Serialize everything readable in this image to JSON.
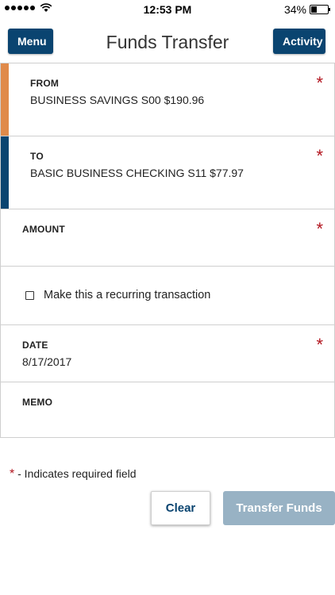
{
  "status_bar": {
    "time": "12:53 PM",
    "battery": "34%",
    "battery_level": 0.34,
    "wifi_icon": "wifi-icon"
  },
  "nav": {
    "menu_label": "Menu",
    "title": "Funds Transfer",
    "activity_label": "Activity"
  },
  "form": {
    "from": {
      "label": "FROM",
      "value": "BUSINESS SAVINGS S00 $190.96",
      "required": "*"
    },
    "to": {
      "label": "TO",
      "value": "BASIC BUSINESS CHECKING S11 $77.97",
      "required": "*"
    },
    "amount": {
      "label": "AMOUNT",
      "value": "",
      "required": "*"
    },
    "recurring": {
      "label": "Make this a recurring transaction",
      "checked": false
    },
    "date": {
      "label": "DATE",
      "value": "8/17/2017",
      "required": "*"
    },
    "memo": {
      "label": "MEMO",
      "value": ""
    }
  },
  "legend": {
    "star": "*",
    "text": " - Indicates required field"
  },
  "actions": {
    "clear_label": "Clear",
    "transfer_label": "Transfer Funds"
  },
  "colors": {
    "primary": "#0a4470",
    "accent_from": "#e08a4a",
    "required": "#b2141e",
    "disabled": "#98b2c4"
  }
}
